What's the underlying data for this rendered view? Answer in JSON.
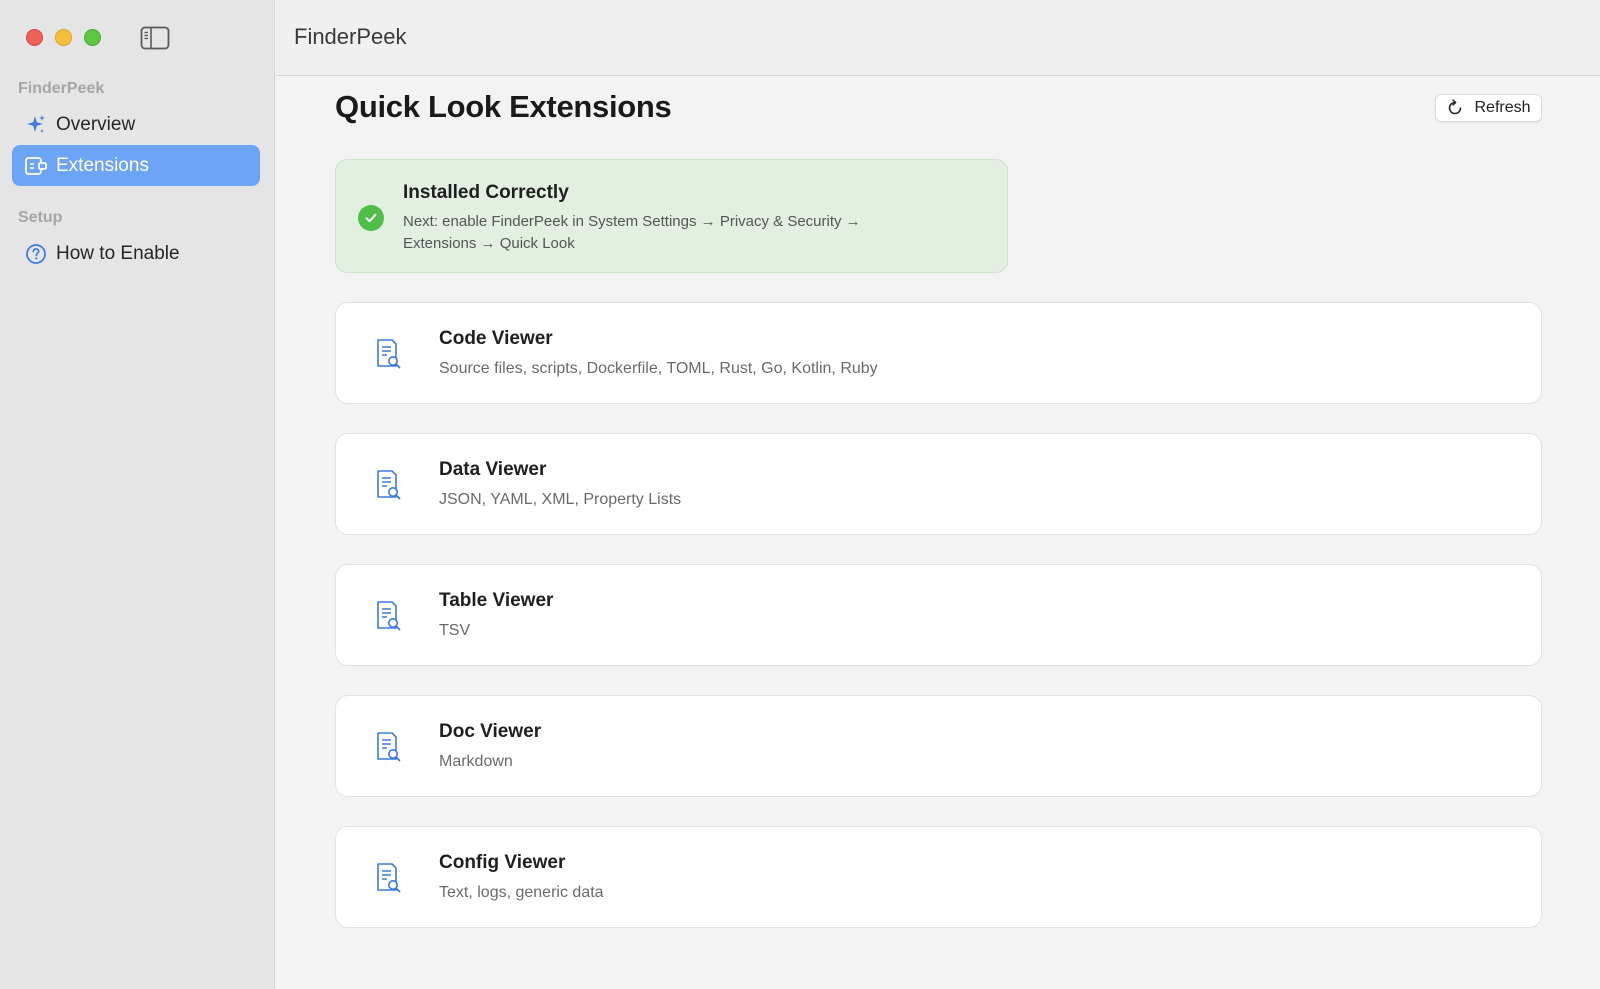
{
  "window": {
    "app_title": "FinderPeek"
  },
  "sidebar": {
    "sections": [
      {
        "title": "FinderPeek",
        "items": [
          {
            "label": "Overview",
            "icon": "sparkles-icon",
            "active": false
          },
          {
            "label": "Extensions",
            "icon": "extensions-icon",
            "active": true
          }
        ]
      },
      {
        "title": "Setup",
        "items": [
          {
            "label": "How to Enable",
            "icon": "question-circle-icon",
            "active": false
          }
        ]
      }
    ]
  },
  "main": {
    "title": "Quick Look Extensions",
    "refresh_label": "Refresh",
    "status": {
      "title": "Installed Correctly",
      "description": "Next: enable FinderPeek in System Settings → Privacy & Security → Extensions → Quick Look",
      "color": "#4fbf48"
    },
    "extensions": [
      {
        "name": "Code Viewer",
        "description": "Source files, scripts, Dockerfile, TOML, Rust, Go, Kotlin, Ruby",
        "icon": "document-search-icon"
      },
      {
        "name": "Data Viewer",
        "description": "JSON, YAML, XML, Property Lists",
        "icon": "document-search-icon"
      },
      {
        "name": "Table Viewer",
        "description": "TSV",
        "icon": "document-search-icon"
      },
      {
        "name": "Doc Viewer",
        "description": "Markdown",
        "icon": "document-search-icon"
      },
      {
        "name": "Config Viewer",
        "description": "Text, logs, generic data",
        "icon": "document-search-icon"
      }
    ]
  },
  "colors": {
    "accent": "#6ea4f5",
    "icon_blue": "#3b7ae0",
    "success": "#4fbf48"
  }
}
